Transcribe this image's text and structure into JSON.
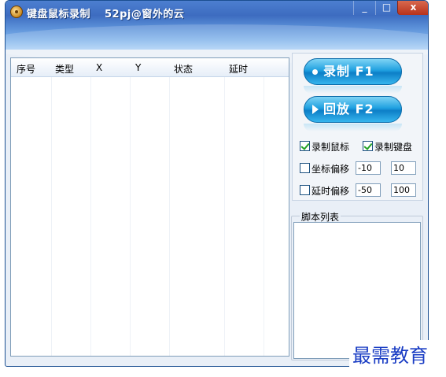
{
  "window": {
    "title": "键盘鼠标录制",
    "subtitle": "52pj@窗外的云",
    "min_glyph": "_",
    "max_glyph": "□",
    "close_glyph": "x"
  },
  "list": {
    "columns": [
      "序号",
      "类型",
      "X",
      "Y",
      "状态",
      "延时"
    ],
    "rows": []
  },
  "buttons": {
    "record": "录制 F1",
    "replay": "回放 F2"
  },
  "options": {
    "record_mouse": {
      "label": "录制鼠标",
      "checked": true
    },
    "record_keyboard": {
      "label": "录制键盘",
      "checked": true
    },
    "coord_offset": {
      "label": "坐标偏移",
      "checked": false,
      "value1": "-10",
      "value2": "10"
    },
    "delay_offset": {
      "label": "延时偏移",
      "checked": false,
      "value1": "-50",
      "value2": "100"
    }
  },
  "script_list": {
    "title": "脚本列表",
    "items": []
  },
  "watermark": "最需教育",
  "colors": {
    "titlebar": "#4c7fd0",
    "button": "#1fa0e0",
    "watermark": "#1a3dc4"
  }
}
